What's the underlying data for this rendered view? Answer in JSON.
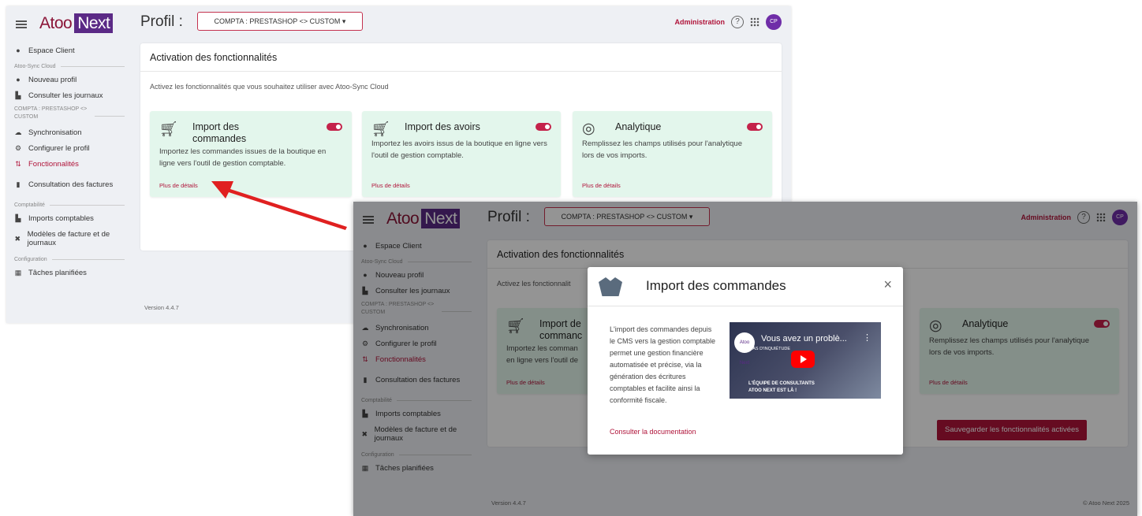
{
  "app": {
    "logo_text": "Atoo",
    "logo_badge": "Next",
    "profil_label": "Profil :",
    "profil_value": "COMPTA : PRESTASHOP <> CUSTOM",
    "admin_label": "Administration",
    "help_label": "?",
    "avatar": "CP"
  },
  "sidebar": {
    "espace_client": "Espace Client",
    "section_atoo": "Atoo-Sync Cloud",
    "nouveau_profil": "Nouveau profil",
    "consulter_journaux": "Consulter les journaux",
    "section_profil": "COMPTA : PRESTASHOP <> CUSTOM",
    "synchronisation": "Synchronisation",
    "configurer_profil": "Configurer le profil",
    "fonctionnalites": "Fonctionnalités",
    "consultation_factures": "Consultation des factures",
    "section_compta": "Comptabilité",
    "imports_comptables": "Imports comptables",
    "modeles_facture": "Modèles de facture et de journaux",
    "section_config": "Configuration",
    "taches_planifiees": "Tâches planifiées"
  },
  "main": {
    "panel_title": "Activation des fonctionnalités",
    "intro": "Activez les fonctionnalités que vous souhaitez utiliser avec Atoo-Sync Cloud",
    "intro_truncated": "Activez les fonctionnalit",
    "cards": [
      {
        "title": "Import des commandes",
        "title_line1": "Import des",
        "title_line2": "commandes",
        "title_line1_cut": "Import de",
        "title_line2_cut": "commanc",
        "desc": "Importez les commandes issues de la boutique en ligne vers l'outil de gestion comptable.",
        "desc_cut1": "Importez les comman",
        "desc_cut2": "en ligne vers l'outil de",
        "more": "Plus de détails",
        "enabled": true
      },
      {
        "title": "Import des avoirs",
        "desc": "Importez les avoirs issus de la boutique en ligne vers l'outil de gestion comptable.",
        "more": "Plus de détails",
        "enabled": true
      },
      {
        "title": "Analytique",
        "desc": "Remplissez les champs utilisés pour l'analytique lors de vos imports.",
        "more": "Plus de détails",
        "enabled": true
      }
    ],
    "save_button": "Sauvegarder les fonctionnalités activées",
    "version": "Version 4.4.7",
    "copyright": "© Atoo Next 2025"
  },
  "modal": {
    "title": "Import des commandes",
    "close": "×",
    "text": "L'import des commandes depuis le CMS vers la gestion comptable permet une gestion financière automatisée et précise, via la génération des écritures comptables et facilite ainsi la conformité fiscale.",
    "doc_link": "Consulter la documentation",
    "video_title": "Vous avez un problè...",
    "video_menu": "⋮",
    "video_channel": "Atoo Next",
    "video_brand": "PAS D'INQUIÉTUDE",
    "video_caption_1": "L'ÉQUIPE DE CONSULTANTS",
    "video_caption_2": "ATOO NEXT EST LÀ !"
  },
  "colors": {
    "brand": "#b0143a",
    "logo_badge": "#5b2a86",
    "card_bg": "#e3f6ec",
    "app_bg": "#eef0f4",
    "arrow": "#e02020"
  }
}
